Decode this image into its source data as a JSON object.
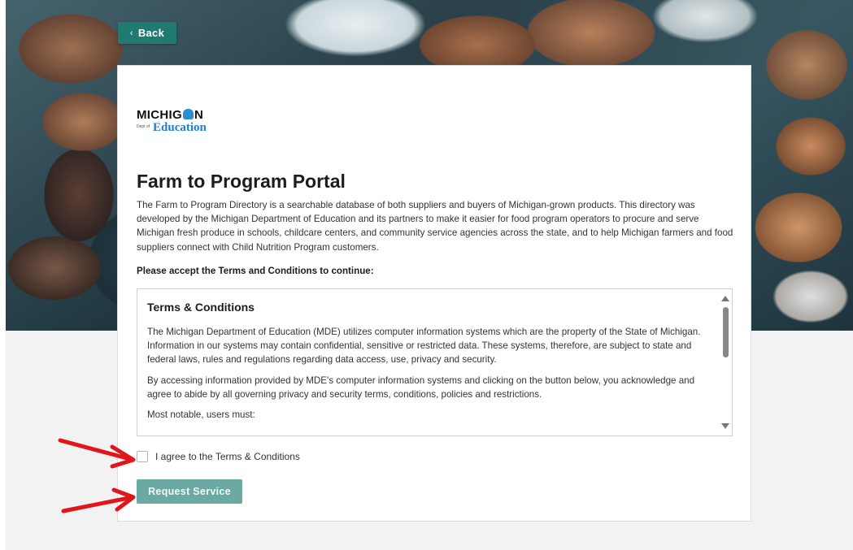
{
  "nav": {
    "back_label": "Back",
    "back_icon": "chevron-left-icon"
  },
  "logo": {
    "line1": "MICHIGAN",
    "dept": "Department of",
    "line2": "Education"
  },
  "portal": {
    "title": "Farm to Program Portal",
    "intro": "The Farm to Program Directory is a searchable database of both suppliers and buyers of Michigan-grown products. This directory was developed by the Michigan Department of Education and its partners to make it easier for food program operators to procure and serve Michigan fresh produce in schools, childcare centers, and community service agencies across the state, and to help Michigan farmers and food suppliers connect with Child Nutrition Program customers.",
    "accept_prompt": "Please accept the Terms and Conditions to continue:"
  },
  "terms": {
    "title": "Terms & Conditions",
    "paragraphs": [
      "The Michigan Department of Education (MDE) utilizes computer information systems which are the property of the State of Michigan. Information in our systems may contain confidential, sensitive or restricted data. These systems, therefore, are subject to state and federal laws, rules and regulations regarding data access, use, privacy and security.",
      "By accessing information provided by MDE's computer information systems and clicking on the button below, you acknowledge and agree to abide by all governing privacy and security terms, conditions, policies and restrictions.",
      "Most notable, users must:"
    ]
  },
  "form": {
    "agree_label": "I agree to the Terms & Conditions",
    "agree_checked": false,
    "submit_label": "Request Service"
  },
  "colors": {
    "primary": "#1f7a72",
    "button_disabled": "#6aaaa3",
    "annotation_arrow": "#e0161b"
  }
}
